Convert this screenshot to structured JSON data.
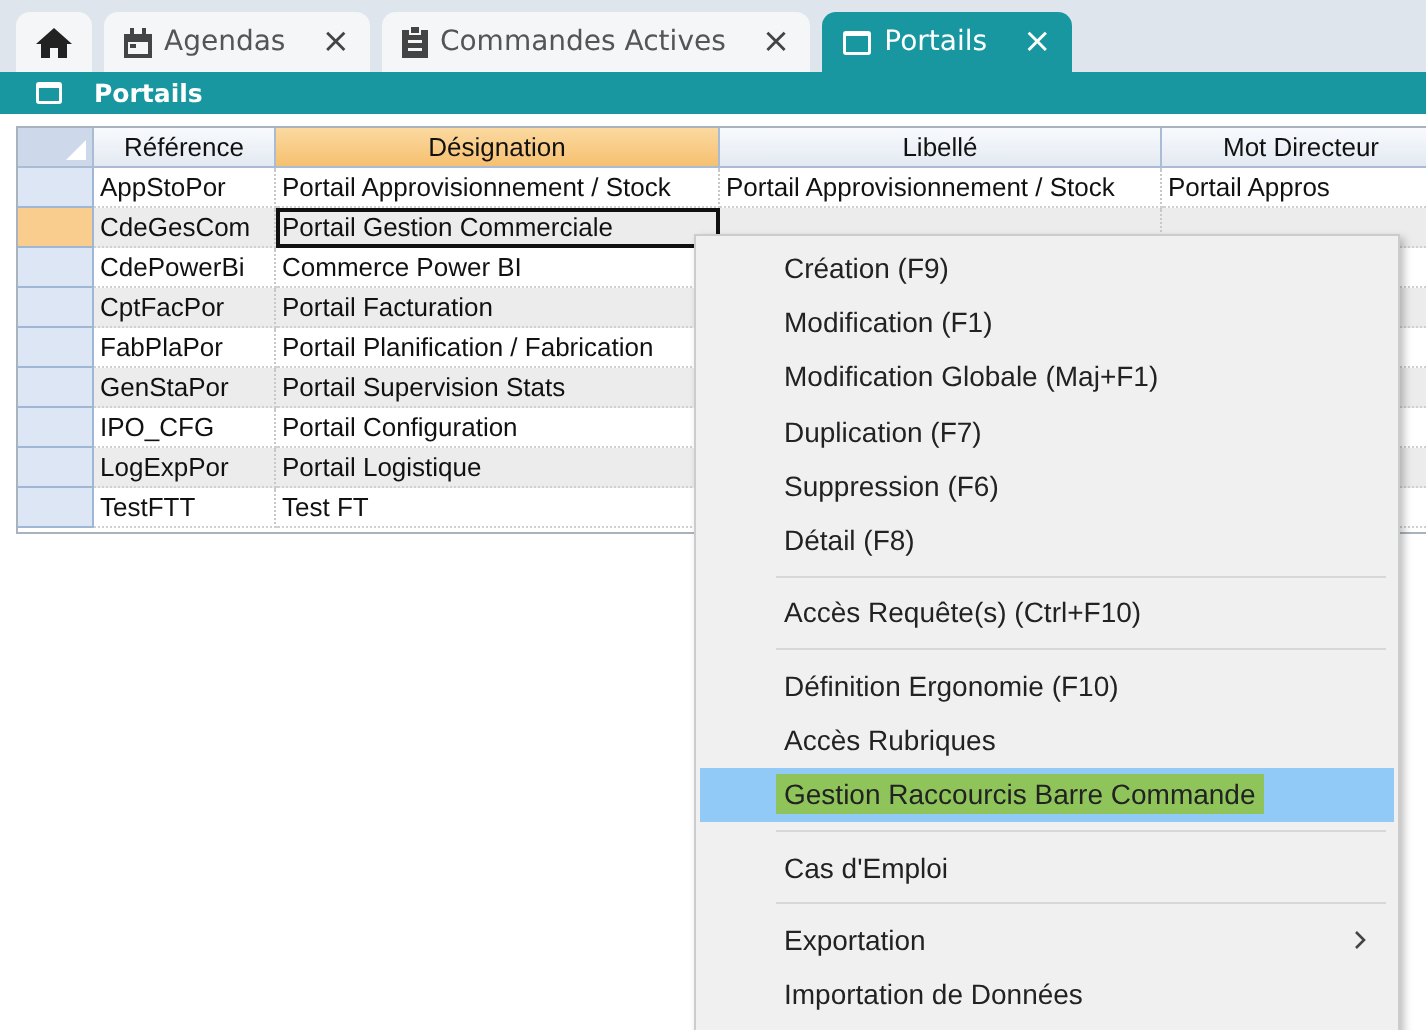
{
  "tabs": [
    {
      "kind": "home",
      "selected": false
    },
    {
      "kind": "calendar",
      "label": "Agendas",
      "closable": true,
      "selected": false
    },
    {
      "kind": "clipboard",
      "label": "Commandes Actives",
      "closable": true,
      "selected": false
    },
    {
      "kind": "window",
      "label": "Portails",
      "closable": true,
      "selected": true
    }
  ],
  "close_glyph": "×",
  "panel": {
    "title": "Portails"
  },
  "table": {
    "columns": [
      {
        "label": "Référence",
        "sorted": false
      },
      {
        "label": "Désignation",
        "sorted": true
      },
      {
        "label": "Libellé",
        "sorted": false
      },
      {
        "label": "Mot Directeur",
        "sorted": false
      }
    ],
    "rows": [
      {
        "cells": [
          "AppStoPor",
          "Portail Approvisionnement / Stock",
          "Portail Approvisionnement / Stock",
          "Portail Appros"
        ],
        "selected": false
      },
      {
        "cells": [
          "CdeGesCom",
          "Portail Gestion Commerciale"
        ],
        "selected": true
      },
      {
        "cells": [
          "CdePowerBi",
          "Commerce Power BI"
        ],
        "selected": false
      },
      {
        "cells": [
          "CptFacPor",
          "Portail Facturation"
        ],
        "selected": false
      },
      {
        "cells": [
          "FabPlaPor",
          "Portail Planification / Fabrication"
        ],
        "selected": false
      },
      {
        "cells": [
          "GenStaPor",
          "Portail Supervision Stats"
        ],
        "selected": false
      },
      {
        "cells": [
          "IPO_CFG",
          "Portail Configuration"
        ],
        "selected": false
      },
      {
        "cells": [
          "LogExpPor",
          "Portail Logistique"
        ],
        "selected": false
      },
      {
        "cells": [
          "TestFTT",
          "Test FT"
        ],
        "selected": false
      }
    ]
  },
  "context_menu": {
    "items": [
      {
        "label": "Création (F9)",
        "selected": false
      },
      {
        "label": "Modification (F1)",
        "selected": false
      },
      {
        "label": "Modification Globale (Maj+F1)",
        "selected": false
      },
      {
        "label": "Duplication (F7)",
        "selected": false
      },
      {
        "label": "Suppression (F6)",
        "selected": false
      },
      {
        "label": "Détail (F8)",
        "selected": false
      },
      {
        "label": "Accès Requête(s) (Ctrl+F10)",
        "separator_before": true,
        "selected": false
      },
      {
        "label": "Définition Ergonomie (F10)",
        "separator_before": true,
        "selected": false
      },
      {
        "label": "Accès Rubriques",
        "selected": false
      },
      {
        "label": "Gestion Raccourcis Barre Commande",
        "selected": true
      },
      {
        "label": "Cas d'Emploi",
        "separator_before": true,
        "selected": false
      },
      {
        "label": "Exportation",
        "separator_before": true,
        "submenu": true,
        "selected": false
      },
      {
        "label": "Importation de Données",
        "selected": false
      }
    ]
  }
}
